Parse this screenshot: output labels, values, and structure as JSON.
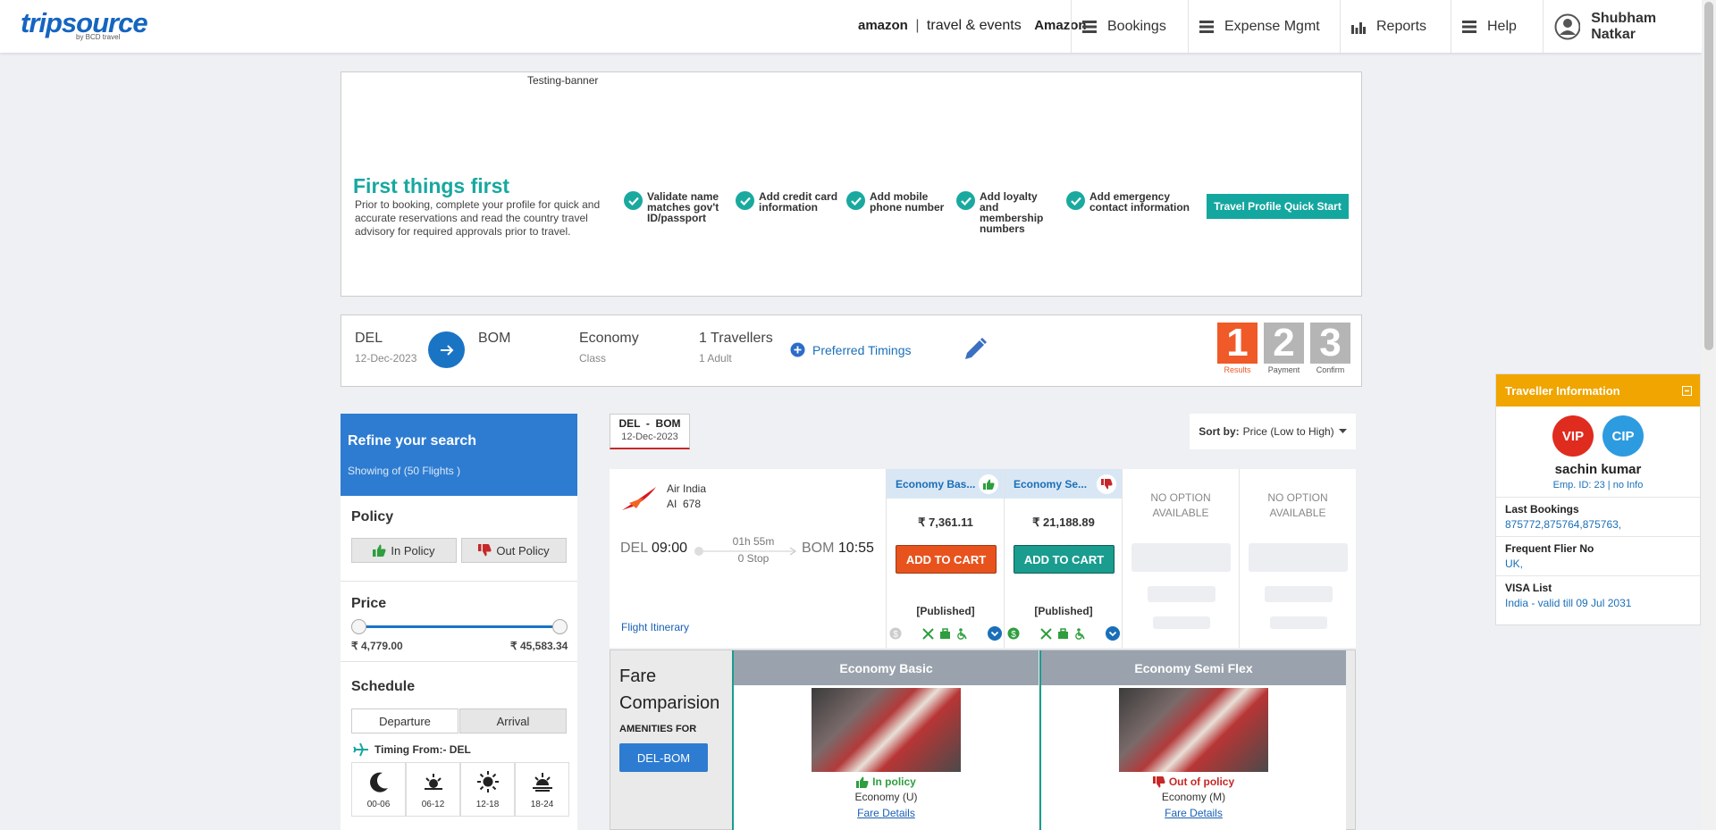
{
  "header": {
    "logo": "tripsource",
    "logo_sub": "by BCD travel",
    "amazon_brand": "amazon",
    "amazon_text": "travel & events",
    "company": "Amazon",
    "nav": [
      {
        "label": "Bookings",
        "icon": "menu-icon"
      },
      {
        "label": "Expense Mgmt",
        "icon": "menu-icon"
      },
      {
        "label": "Reports",
        "icon": "bar-chart-icon"
      },
      {
        "label": "Help",
        "icon": "menu-icon"
      }
    ],
    "user": "Shubham Natkar"
  },
  "banner": {
    "label": "Testing-banner",
    "title": "First things first",
    "description": "Prior to booking, complete your profile for quick and accurate reservations and read the country travel advisory for required approvals prior to travel.",
    "checks": [
      "Validate name matches gov't ID/passport",
      "Add credit card information",
      "Add mobile phone number",
      "Add loyalty and membership numbers",
      "Add emergency contact information"
    ],
    "cta": "Travel Profile Quick Start"
  },
  "search": {
    "from": "DEL",
    "date": "12-Dec-2023",
    "to": "BOM",
    "cabin": "Economy",
    "cabin_label": "Class",
    "travellers": "1 Travellers",
    "travellers_detail": "1 Adult",
    "preferred_timings": "Preferred Timings",
    "steps": [
      {
        "num": "1",
        "label": "Results"
      },
      {
        "num": "2",
        "label": "Payment"
      },
      {
        "num": "3",
        "label": "Confirm"
      }
    ]
  },
  "sidebar": {
    "title": "Refine your search",
    "showing": "Showing of (50 Flights )",
    "policy_title": "Policy",
    "in_policy": "In Policy",
    "out_policy": "Out Policy",
    "price_title": "Price",
    "price_min": "₹ 4,779.00",
    "price_max": "₹ 45,583.34",
    "schedule_title": "Schedule",
    "departure": "Departure",
    "arrival": "Arrival",
    "timing_from": "Timing From:- DEL",
    "slots": [
      "00-06",
      "06-12",
      "12-18",
      "18-24"
    ]
  },
  "results": {
    "route": "DEL  -  BOM",
    "route_date": "12-Dec-2023",
    "sort_label": "Sort by:",
    "sort_value": "Price (Low to High)",
    "flight": {
      "airline": "Air India",
      "flight_no": "AI  678",
      "dep_code": "DEL",
      "dep_time": "09:00",
      "duration": "01h 55m",
      "stops": "0 Stop",
      "arr_code": "BOM",
      "arr_time": "10:55",
      "itinerary_link": "Flight Itinerary"
    },
    "fares": [
      {
        "name": "Economy Bas...",
        "price": "₹ 7,361.11",
        "button": "ADD TO CART",
        "type": "[Published]"
      },
      {
        "name": "Economy Se...",
        "price": "₹ 21,188.89",
        "button": "ADD TO CART",
        "type": "[Published]"
      }
    ],
    "no_option": "NO OPTION AVAILABLE"
  },
  "comparison": {
    "title": "Fare Comparision",
    "amenities_for": "AMENITIES FOR",
    "route_btn": "DEL-BOM",
    "columns": [
      {
        "name": "Economy Basic",
        "policy": "In policy",
        "class": "Economy (U)",
        "link": "Fare Details"
      },
      {
        "name": "Economy Semi Flex",
        "policy": "Out of policy",
        "class": "Economy (M)",
        "link": "Fare Details"
      }
    ]
  },
  "traveller": {
    "title": "Traveller Information",
    "badges": [
      "VIP",
      "CIP"
    ],
    "name": "sachin kumar",
    "emp": "Emp. ID: 23 | no Info",
    "last_bookings_label": "Last Bookings",
    "last_bookings": "875772,875764,875763,",
    "ff_label": "Frequent Flier No",
    "ff_value": "UK,",
    "visa_label": "VISA List",
    "visa_value": "India - valid till 09 Jul 2031"
  },
  "colors": {
    "brand_blue": "#1a74c4",
    "teal": "#14a7a0",
    "step_active": "#f05a28",
    "cart_orange": "#e8531d",
    "cart_teal": "#1a9c8f",
    "traveller_header": "#f0a500"
  }
}
